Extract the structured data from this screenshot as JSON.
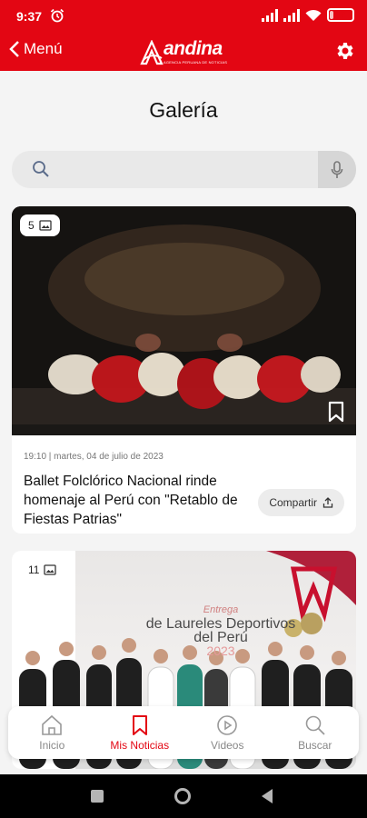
{
  "status": {
    "time": "9:37",
    "battery": "17"
  },
  "header": {
    "back_label": "Menú",
    "logo_text": "andina",
    "logo_subtitle": "AGENCIA PERUANA DE NOTICIAS"
  },
  "page": {
    "title": "Galería"
  },
  "search": {
    "placeholder": ""
  },
  "cards": [
    {
      "image_count": "5",
      "timestamp": "19:10 | martes, 04 de julio de 2023",
      "title": "Ballet Folclórico Nacional rinde homenaje al Perú con \"Retablo de Fiestas Patrias\"",
      "share_label": "Compartir"
    },
    {
      "image_count": "11",
      "banner_small": "Entrega",
      "banner_title": "de Laureles Deportivos del Perú",
      "banner_year": "2023"
    }
  ],
  "nav": {
    "items": [
      {
        "label": "Inicio",
        "icon": "home-icon",
        "active": false
      },
      {
        "label": "Mis Noticias",
        "icon": "bookmark-icon",
        "active": true
      },
      {
        "label": "Videos",
        "icon": "play-icon",
        "active": false
      },
      {
        "label": "Buscar",
        "icon": "search-icon",
        "active": false
      }
    ]
  },
  "colors": {
    "brand": "#e30613",
    "nav_inactive": "#888888"
  }
}
